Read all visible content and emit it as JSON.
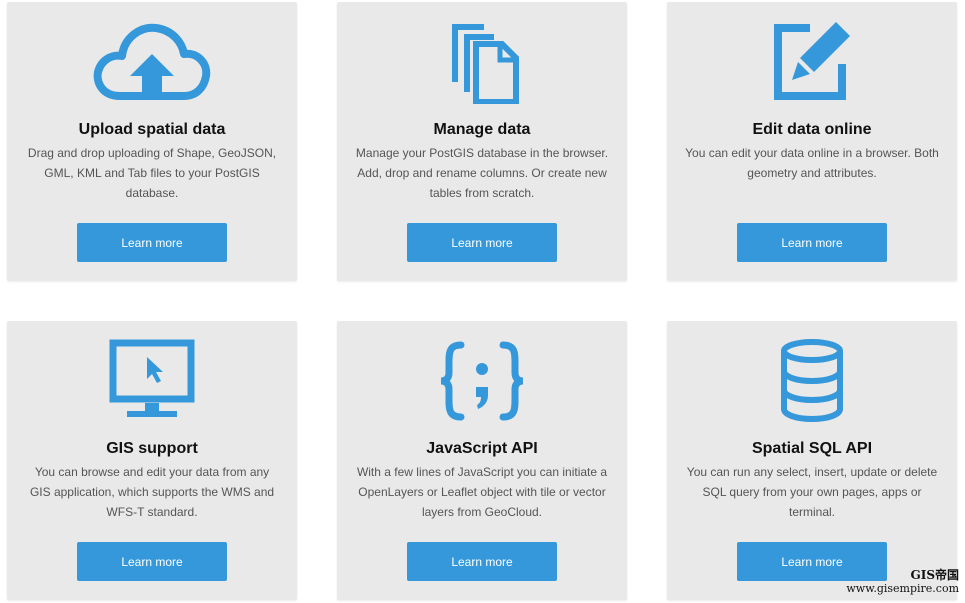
{
  "cards": [
    {
      "icon": "cloud-upload-icon",
      "title": "Upload spatial data",
      "description": "Drag and drop uploading of Shape, GeoJSON, GML, KML and Tab files to your PostGIS database.",
      "button": "Learn more"
    },
    {
      "icon": "documents-icon",
      "title": "Manage data",
      "description": "Manage your PostGIS database in the browser. Add, drop and rename columns. Or create new tables from scratch.",
      "button": "Learn more"
    },
    {
      "icon": "edit-icon",
      "title": "Edit data online",
      "description": "You can edit your data online in a browser. Both geometry and attributes.",
      "button": "Learn more"
    },
    {
      "icon": "monitor-cursor-icon",
      "title": "GIS support",
      "description": "You can browse and edit your data from any GIS application, which supports the WMS and WFS-T standard.",
      "button": "Learn more"
    },
    {
      "icon": "code-braces-icon",
      "title": "JavaScript API",
      "description": "With a few lines of JavaScript you can initiate a OpenLayers or Leaflet object with tile or vector layers from GeoCloud.",
      "button": "Learn more"
    },
    {
      "icon": "database-icon",
      "title": "Spatial SQL API",
      "description": "You can run any select, insert, update or delete SQL query from your own pages, apps or terminal.",
      "button": "Learn more"
    }
  ],
  "watermark": {
    "brand": "GIS帝国",
    "url": "www.gisempire.com"
  },
  "colors": {
    "accent": "#3498db",
    "card_bg": "#e9e9e9"
  }
}
